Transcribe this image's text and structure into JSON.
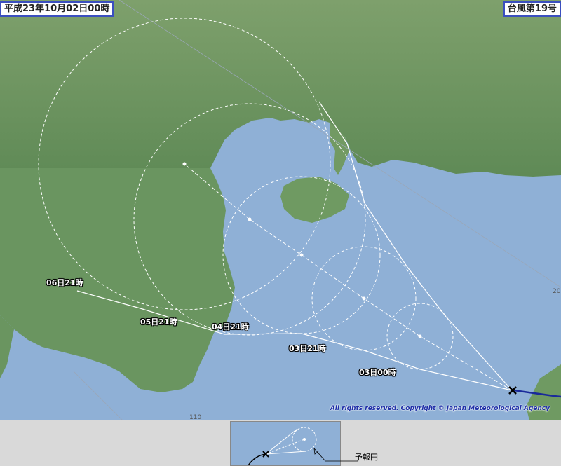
{
  "header": {
    "issue_time": "平成23年10月02日00時",
    "typhoon_name": "台風第19号"
  },
  "forecast_points": [
    {
      "label": "03日00時"
    },
    {
      "label": "03日21時"
    },
    {
      "label": "04日21時"
    },
    {
      "label": "05日21時"
    },
    {
      "label": "06日21時"
    }
  ],
  "grid_labels": {
    "longitude": "110",
    "latitude": "20"
  },
  "copyright": "All rights reserved. Copyright © Japan Meteorological Agency",
  "legend": {
    "label": "予報円"
  },
  "colors": {
    "sea": "#8fb0d6",
    "land": "#6f9a62",
    "track": "#1a2a9a",
    "label_border": "#3b4fbf"
  }
}
